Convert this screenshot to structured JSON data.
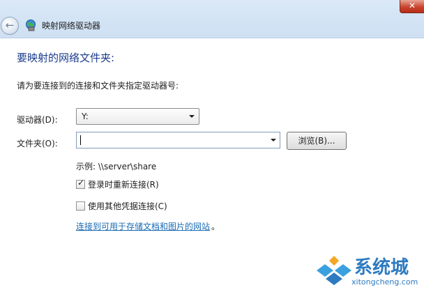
{
  "window": {
    "title": "映射网络驱动器",
    "close_glyph": "✕",
    "back_glyph": "←"
  },
  "content": {
    "heading": "要映射的网络文件夹:",
    "instruction": "请为要连接到的连接和文件夹指定驱动器号:",
    "drive_label": "驱动器(D):",
    "drive_value": "Y:",
    "folder_label": "文件夹(O):",
    "folder_value": "",
    "browse_label": "浏览(B)...",
    "example": "示例: \\\\server\\share",
    "reconnect_label": "登录时重新连接(R)",
    "reconnect_checked": true,
    "other_credentials_label": "使用其他凭据连接(C)",
    "other_credentials_checked": false,
    "link_text": "连接到可用于存储文档和图片的网站",
    "link_suffix": "。"
  },
  "watermark": {
    "text": "系统城",
    "url": "xitongcheng.com"
  },
  "icons": {
    "back": "back-arrow-icon",
    "network": "network-drive-icon",
    "close": "close-icon",
    "dropdown": "chevron-down-icon",
    "checkmark": "checkmark-icon"
  },
  "colors": {
    "heading": "#1c3c8c",
    "link": "#1a6bb5",
    "close_button": "#c9452f",
    "watermark": "#2d7ac1"
  }
}
